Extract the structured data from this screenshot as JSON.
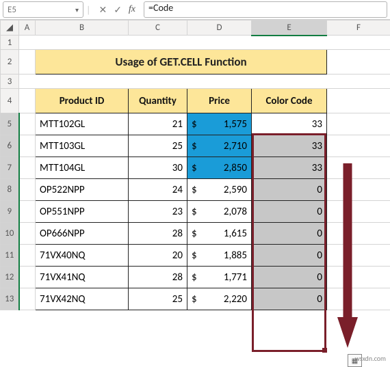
{
  "namebox": "E5",
  "formula": "=Code",
  "icons": {
    "cancel": "✕",
    "confirm": "✓",
    "fx": "fx"
  },
  "columns": [
    "A",
    "B",
    "C",
    "D",
    "E",
    "F"
  ],
  "title": "Usage of GET.CELL Function",
  "headers": {
    "product_id": "Product ID",
    "quantity": "Quantity",
    "price": "Price",
    "color_code": "Color Code"
  },
  "currency": "$",
  "rows": [
    {
      "n": 5,
      "pid": "MTT102GL",
      "qty": 21,
      "price": "1,575",
      "hl": true,
      "code": 33,
      "first": true
    },
    {
      "n": 6,
      "pid": "MTT103GL",
      "qty": 25,
      "price": "2,710",
      "hl": true,
      "code": 33
    },
    {
      "n": 7,
      "pid": "MTT104GL",
      "qty": 30,
      "price": "2,850",
      "hl": true,
      "code": 33
    },
    {
      "n": 8,
      "pid": "OP522NPP",
      "qty": 24,
      "price": "2,590",
      "hl": false,
      "code": 0
    },
    {
      "n": 9,
      "pid": "OP551NPP",
      "qty": 23,
      "price": "2,078",
      "hl": false,
      "code": 0
    },
    {
      "n": 10,
      "pid": "OP666NPP",
      "qty": 28,
      "price": "1,615",
      "hl": false,
      "code": 0
    },
    {
      "n": 11,
      "pid": "71VX40NQ",
      "qty": 20,
      "price": "1,885",
      "hl": false,
      "code": 0
    },
    {
      "n": 12,
      "pid": "71VX41NQ",
      "qty": 28,
      "price": "1,771",
      "hl": false,
      "code": 0
    },
    {
      "n": 13,
      "pid": "71VX42NQ",
      "qty": 25,
      "price": "2,220",
      "hl": false,
      "code": 0
    }
  ],
  "watermark": "wsxdn.com",
  "autofill_icon": "▦"
}
